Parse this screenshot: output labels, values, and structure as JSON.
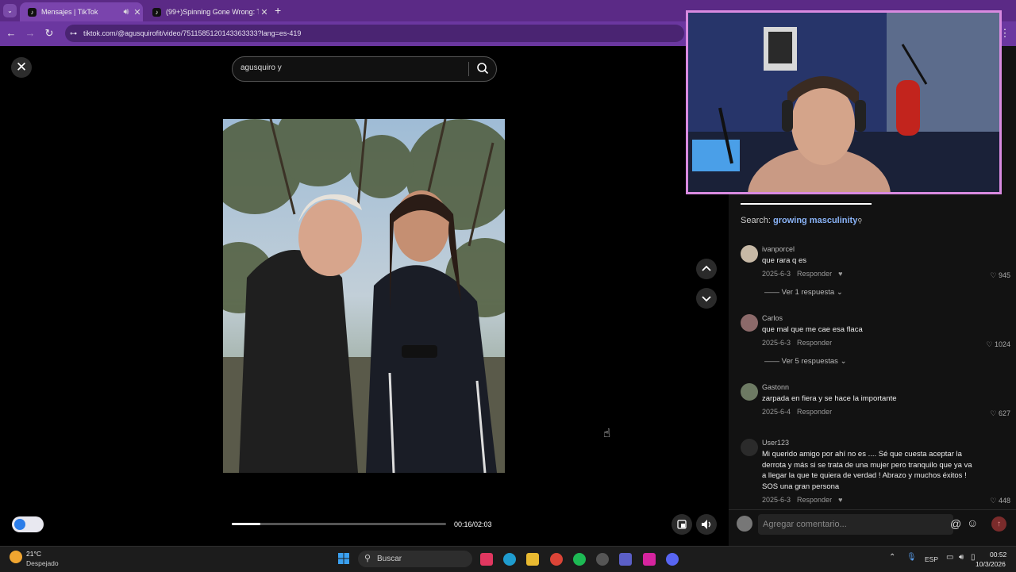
{
  "browser": {
    "tabs": [
      {
        "title": "Mensajes | TikTok",
        "active": true
      },
      {
        "title": "(99+)Spinning Gone Wrong: Th",
        "active": false
      }
    ],
    "url": "tiktok.com/@agusquirofit/video/7511585120143363333?lang=es-419"
  },
  "video": {
    "search_value": "agusquiro y",
    "progress_fraction": 0.133,
    "time": "00:16/02:03"
  },
  "comments": {
    "search_label": "Search:",
    "search_term": "growing masculinity",
    "items": [
      {
        "user": "ivanporcel",
        "text": "que rara q es",
        "date": "2025-6-3",
        "reply": "Responder",
        "likes": "945",
        "replies": "Ver 1 respuesta"
      },
      {
        "user": "Carlos",
        "text": "que mal que me cae esa flaca",
        "date": "2025-6-3",
        "reply": "Responder",
        "likes": "1024",
        "replies": "Ver 5 respuestas"
      },
      {
        "user": "Gastonn",
        "text": "zarpada en fiera y se hace la importante",
        "date": "2025-6-4",
        "reply": "Responder",
        "likes": "627"
      },
      {
        "user": "User123",
        "text": "Mi querido amigo por ahí no es .... Sé que cuesta aceptar la derrota y más si se trata de una mujer pero tranquilo que ya va a llegar la que te quiera de verdad ! Abrazo y muchos éxitos ! SOS una gran persona",
        "date": "2025-6-3",
        "reply": "Responder",
        "likes": "448"
      }
    ],
    "input_placeholder": "Agregar comentario..."
  },
  "taskbar": {
    "weather_temp": "21°C",
    "weather_desc": "Despejado",
    "search_placeholder": "Buscar",
    "lang": "ESP",
    "time": "00:52",
    "date": "10/3/2026"
  },
  "colors": {
    "accent_purple": "#5b2a86",
    "webcam_border": "#d88ae0",
    "post_button": "#c0392b"
  }
}
